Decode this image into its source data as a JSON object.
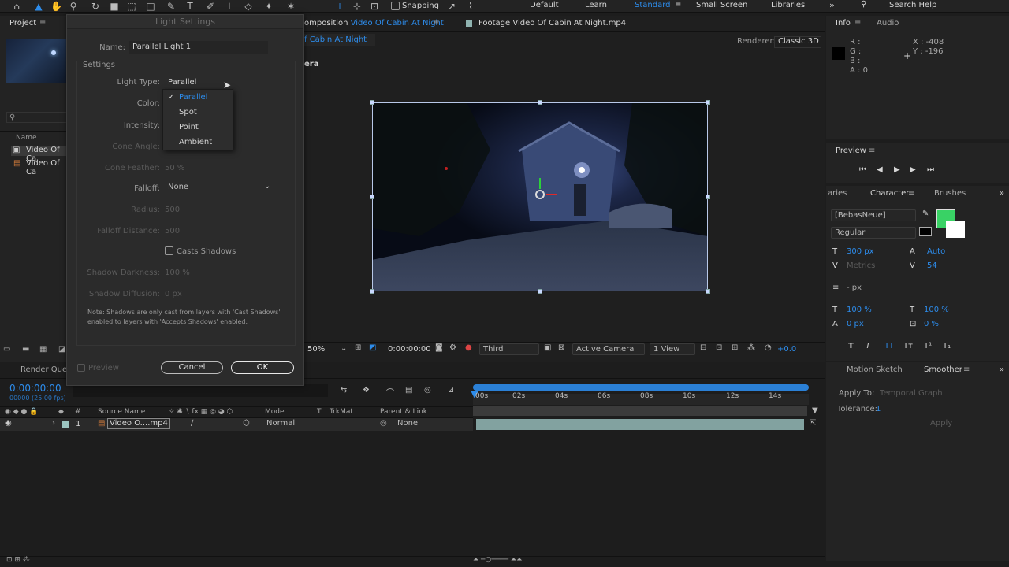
{
  "toolbar": {
    "snapping": "Snapping",
    "workspaces": [
      "Default",
      "Learn",
      "Standard",
      "Small Screen",
      "Libraries"
    ],
    "search": "Search Help"
  },
  "project": {
    "tab": "Project",
    "items": [
      "Video Of Ca",
      "Video Of Ca"
    ],
    "header": "Name",
    "render_queue": "Render Queue"
  },
  "comp": {
    "tab_prefix": "omposition ",
    "tab_name": "Video Of Cabin At Night",
    "footage_tab": "Footage Video Of Cabin At Night.mp4",
    "breadcrumb": "f Cabin At Night",
    "renderer_label": "Renderer:",
    "renderer": "Classic 3D",
    "camera_label": "era",
    "zoom": "50%",
    "time": "0:00:00:00",
    "resolution": "Third",
    "camera": "Active Camera",
    "views": "1 View",
    "exposure": "+0.0"
  },
  "info": {
    "tab": "Info",
    "tab2": "Audio",
    "r": "R :",
    "g": "G :",
    "b": "B :",
    "a": "A : 0",
    "x": "X : -408",
    "y": "Y : -196"
  },
  "preview": {
    "title": "Preview"
  },
  "character": {
    "tab_left": "aries",
    "tab": "Character",
    "tab2": "Brushes",
    "font": "[BebasNeue]",
    "style": "Regular",
    "size": "300 px",
    "leading": "Auto",
    "kerning": "Metrics",
    "tracking": "54",
    "stroke": "- px",
    "vscale": "100 %",
    "hscale": "100 %",
    "baseline": "0 px",
    "tsume": "0 %",
    "fill_color": "#39d265"
  },
  "smoother": {
    "tab1": "Motion Sketch",
    "tab2": "Smoother",
    "apply_to_label": "Apply To:",
    "apply_to": "Temporal Graph",
    "tolerance_label": "Tolerance:",
    "tolerance": "1",
    "apply": "Apply"
  },
  "timeline": {
    "timecode": "0:00:00:00",
    "fps": "00000 (25.00 fps)",
    "col_source": "Source Name",
    "col_mode": "Mode",
    "col_t": "T",
    "col_trkmat": "TrkMat",
    "col_parent": "Parent & Link",
    "layer_num": "1",
    "layer_name": "Video O....mp4",
    "layer_mode": "Normal",
    "layer_parent": "None",
    "ticks": [
      "00s",
      "02s",
      "04s",
      "06s",
      "08s",
      "10s",
      "12s",
      "14s"
    ]
  },
  "dialog": {
    "title": "Light Settings",
    "name_label": "Name:",
    "name_value": "Parallel Light 1",
    "settings": "Settings",
    "light_type_label": "Light Type:",
    "light_type": "Parallel",
    "color_label": "Color:",
    "intensity_label": "Intensity:",
    "cone_angle_label": "Cone Angle:",
    "cone_feather_label": "Cone Feather:",
    "cone_feather": "50 %",
    "falloff_label": "Falloff:",
    "falloff": "None",
    "radius_label": "Radius:",
    "radius": "500",
    "falloff_distance_label": "Falloff Distance:",
    "falloff_distance": "500",
    "casts_shadows": "Casts Shadows",
    "shadow_darkness_label": "Shadow Darkness:",
    "shadow_darkness": "100 %",
    "shadow_diffusion_label": "Shadow Diffusion:",
    "shadow_diffusion": "0 px",
    "note": "Note: Shadows are only cast from layers with 'Cast Shadows' enabled to layers with 'Accepts Shadows' enabled.",
    "preview": "Preview",
    "cancel": "Cancel",
    "ok": "OK",
    "menu": [
      "Parallel",
      "Spot",
      "Point",
      "Ambient"
    ]
  }
}
